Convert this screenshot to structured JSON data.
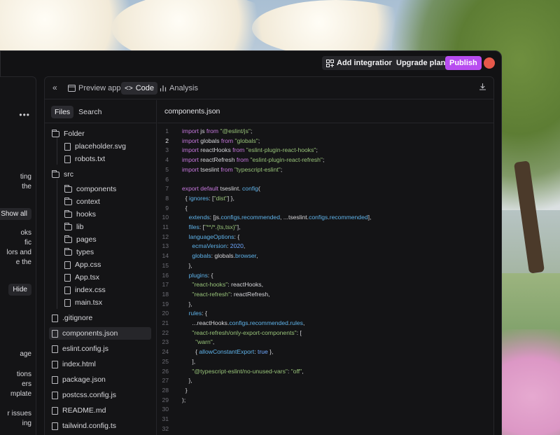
{
  "topbar": {
    "add_integration": "Add integration",
    "upgrade_plan": "Upgrade plan",
    "publish": "Publish"
  },
  "chat_panel": {
    "fragments": [
      "ting",
      "the",
      "oks",
      "fic",
      "lors and",
      "e the",
      "age",
      "tions",
      "ers",
      "mplate",
      "r issues",
      "ing"
    ],
    "show_all": "Show all",
    "hide": "Hide"
  },
  "code_panel": {
    "tabs": [
      {
        "label": "Preview app",
        "icon": "monitor-icon"
      },
      {
        "label": "Code",
        "icon": "code-icon"
      },
      {
        "label": "Analysis",
        "icon": "bar-chart-icon"
      }
    ],
    "file_tabs": [
      "Files",
      "Search"
    ],
    "tree": [
      {
        "name": "Folder",
        "type": "folder",
        "depth": 0
      },
      {
        "name": "placeholder.svg",
        "type": "file",
        "depth": 1
      },
      {
        "name": "robots.txt",
        "type": "file",
        "depth": 1
      },
      {
        "name": "src",
        "type": "folder",
        "depth": 0
      },
      {
        "name": "components",
        "type": "folder",
        "depth": 1
      },
      {
        "name": "context",
        "type": "folder",
        "depth": 1
      },
      {
        "name": "hooks",
        "type": "folder",
        "depth": 1
      },
      {
        "name": "lib",
        "type": "folder",
        "depth": 1
      },
      {
        "name": "pages",
        "type": "folder",
        "depth": 1
      },
      {
        "name": "types",
        "type": "folder",
        "depth": 1
      },
      {
        "name": "App.css",
        "type": "file",
        "depth": 1
      },
      {
        "name": "App.tsx",
        "type": "file",
        "depth": 1
      },
      {
        "name": "index.css",
        "type": "file",
        "depth": 1
      },
      {
        "name": "main.tsx",
        "type": "file",
        "depth": 1
      },
      {
        "name": ".gitignore",
        "type": "file",
        "depth": 0
      },
      {
        "name": "components.json",
        "type": "file",
        "depth": 0,
        "selected": true
      },
      {
        "name": "eslint.config.js",
        "type": "file",
        "depth": 0
      },
      {
        "name": "index.html",
        "type": "file",
        "depth": 0
      },
      {
        "name": "package.json",
        "type": "file",
        "depth": 0
      },
      {
        "name": "postcss.config.js",
        "type": "file",
        "depth": 0
      },
      {
        "name": "README.md",
        "type": "file",
        "depth": 0
      },
      {
        "name": "tailwind.config.ts",
        "type": "file",
        "depth": 0
      }
    ],
    "editor": {
      "filename": "components.json",
      "current_line": 2,
      "lines": [
        [
          [
            "k",
            "import"
          ],
          [
            "t",
            " js "
          ],
          [
            "k",
            "from"
          ],
          [
            "s",
            " \"@eslint/js\""
          ],
          [
            "t",
            ";"
          ]
        ],
        [
          [
            "k",
            "import"
          ],
          [
            "t",
            " globals "
          ],
          [
            "k",
            "from"
          ],
          [
            "s",
            " \"globals\""
          ],
          [
            "t",
            ";"
          ]
        ],
        [
          [
            "k",
            "import"
          ],
          [
            "t",
            " reactHooks "
          ],
          [
            "k",
            "from"
          ],
          [
            "s",
            " \"eslint-plugin-react-hooks\""
          ],
          [
            "t",
            ";"
          ]
        ],
        [
          [
            "k",
            "import"
          ],
          [
            "t",
            " reactRefresh "
          ],
          [
            "k",
            "from"
          ],
          [
            "s",
            " \"eslint-plugin-react-refresh\""
          ],
          [
            "t",
            ";"
          ]
        ],
        [
          [
            "k",
            "import"
          ],
          [
            "t",
            " tseslint "
          ],
          [
            "k",
            "from"
          ],
          [
            "s",
            " \"typescript-eslint\""
          ],
          [
            "t",
            ";"
          ]
        ],
        [],
        [
          [
            "k",
            "export default"
          ],
          [
            "t",
            " tseslint. "
          ],
          [
            "p",
            "config"
          ],
          [
            "t",
            "("
          ]
        ],
        [
          [
            "t",
            "  { "
          ],
          [
            "p",
            "ignores"
          ],
          [
            "t",
            ": ["
          ],
          [
            "s",
            "\"dist\""
          ],
          [
            "t",
            "] },"
          ]
        ],
        [
          [
            "t",
            "  {"
          ]
        ],
        [
          [
            "t",
            "    "
          ],
          [
            "p",
            "extends"
          ],
          [
            "t",
            ": [js."
          ],
          [
            "p",
            "configs"
          ],
          [
            "t",
            "."
          ],
          [
            "p",
            "recommended"
          ],
          [
            "t",
            ", ...tseslint."
          ],
          [
            "p",
            "configs"
          ],
          [
            "t",
            "."
          ],
          [
            "p",
            "recommended"
          ],
          [
            "t",
            "],"
          ]
        ],
        [
          [
            "t",
            "    "
          ],
          [
            "p",
            "files"
          ],
          [
            "t",
            ": ["
          ],
          [
            "s",
            "\"**/*.{ts,tsx}\""
          ],
          [
            "t",
            "],"
          ]
        ],
        [
          [
            "t",
            "    "
          ],
          [
            "p",
            "languageOptions"
          ],
          [
            "t",
            ": {"
          ]
        ],
        [
          [
            "t",
            "      "
          ],
          [
            "p",
            "ecmaVersion"
          ],
          [
            "t",
            ": "
          ],
          [
            "b",
            "2020"
          ],
          [
            "t",
            ","
          ]
        ],
        [
          [
            "t",
            "      "
          ],
          [
            "p",
            "globals"
          ],
          [
            "t",
            ": globals."
          ],
          [
            "p",
            "browser"
          ],
          [
            "t",
            ","
          ]
        ],
        [
          [
            "t",
            "    },"
          ]
        ],
        [
          [
            "t",
            "    "
          ],
          [
            "p",
            "plugins"
          ],
          [
            "t",
            ": {"
          ]
        ],
        [
          [
            "s",
            "      \"react-hooks\""
          ],
          [
            "t",
            ": reactHooks,"
          ]
        ],
        [
          [
            "s",
            "      \"react-refresh\""
          ],
          [
            "t",
            ": reactRefresh,"
          ]
        ],
        [
          [
            "t",
            "    },"
          ]
        ],
        [
          [
            "t",
            "    "
          ],
          [
            "p",
            "rules"
          ],
          [
            "t",
            ": {"
          ]
        ],
        [
          [
            "t",
            "      ...reactHooks."
          ],
          [
            "p",
            "configs"
          ],
          [
            "t",
            "."
          ],
          [
            "p",
            "recommended"
          ],
          [
            "t",
            "."
          ],
          [
            "p",
            "rules"
          ],
          [
            "t",
            ","
          ]
        ],
        [
          [
            "s",
            "      \"react-refresh/only-export-components\""
          ],
          [
            "t",
            ": ["
          ]
        ],
        [
          [
            "s",
            "        \"warn\""
          ],
          [
            "t",
            ","
          ]
        ],
        [
          [
            "t",
            "        { "
          ],
          [
            "p",
            "allowConstantExport"
          ],
          [
            "t",
            ": "
          ],
          [
            "b",
            "true"
          ],
          [
            "t",
            " },"
          ]
        ],
        [
          [
            "t",
            "      ],"
          ]
        ],
        [
          [
            "s",
            "      \"@typescript-eslint/no-unused-vars\""
          ],
          [
            "t",
            ": "
          ],
          [
            "s",
            "\"off\""
          ],
          [
            "t",
            ","
          ]
        ],
        [
          [
            "t",
            "    },"
          ]
        ],
        [
          [
            "t",
            "  }"
          ]
        ],
        [
          [
            "t",
            ");"
          ]
        ],
        [],
        [],
        []
      ]
    }
  }
}
